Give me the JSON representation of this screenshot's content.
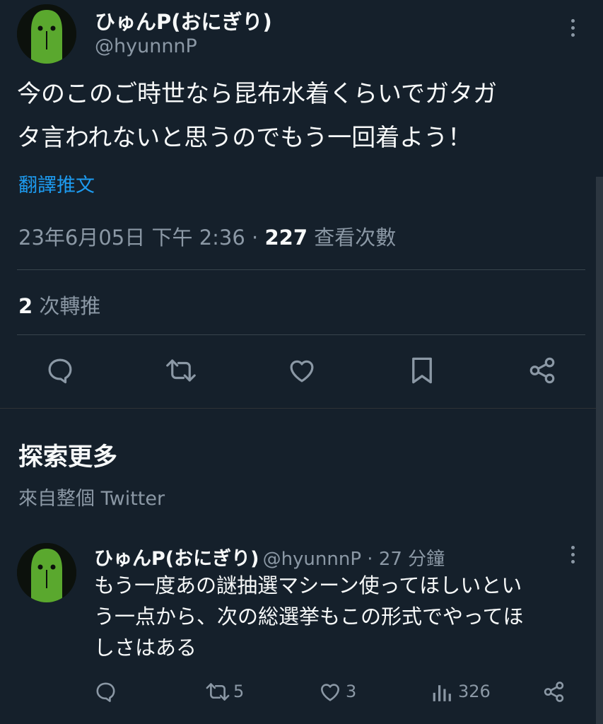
{
  "tweet": {
    "author_name": "ひゅんP(おにぎり)",
    "author_handle": "@hyunnnP",
    "text_line1": "今のこのご時世なら昆布水着くらいでガタガ",
    "text_line2": "タ言われないと思うのでもう一回着よう！",
    "translate_link": "翻譯推文",
    "timestamp": "23年6月05日 下午 2:36",
    "separator": " · ",
    "views_count": "227",
    "views_label": " 查看次數",
    "retweets_count": "2",
    "retweets_label": " 次轉推"
  },
  "explore": {
    "title": "探索更多",
    "subtitle": "來自整個 Twitter"
  },
  "related_tweet": {
    "author_name": "ひゅんP(おにぎり)",
    "author_handle": "@hyunnnP",
    "time": " · 27 分鐘",
    "text_line1": "もう一度あの謎抽選マシーン使ってほしいとい",
    "text_line2": "う一点から、次の総選挙もこの形式でやってほ",
    "text_line3": "しさはある",
    "retweet_count": "5",
    "like_count": "3",
    "view_count": "326"
  },
  "icons": {
    "reply": "reply-icon",
    "retweet": "retweet-icon",
    "like": "heart-icon",
    "bookmark": "bookmark-icon",
    "share": "share-icon",
    "views": "views-icon",
    "more": "more-icon"
  },
  "colors": {
    "background": "#15202b",
    "text": "#f7f9f9",
    "muted": "#8b98a5",
    "link": "#1d9bf0",
    "divider": "#38444d"
  }
}
